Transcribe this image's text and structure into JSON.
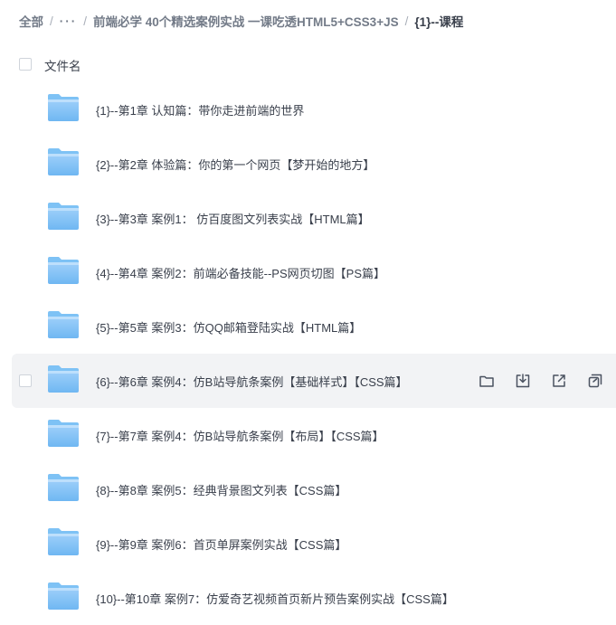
{
  "breadcrumb": {
    "root": "全部",
    "ellipsis": "···",
    "parent": "前端必学 40个精选案例实战 一课吃透HTML5+CSS3+JS",
    "current": "{1}--课程",
    "separator": "/"
  },
  "list_header": {
    "name_label": "文件名"
  },
  "files": [
    {
      "name": "{1}--第1章 认知篇：带你走进前端的世界"
    },
    {
      "name": "{2}--第2章 体验篇：你的第一个网页【梦开始的地方】"
    },
    {
      "name": "{3}--第3章 案例1： 仿百度图文列表实战【HTML篇】"
    },
    {
      "name": "{4}--第4章 案例2：前端必备技能--PS网页切图【PS篇】"
    },
    {
      "name": "{5}--第5章 案例3：仿QQ邮箱登陆实战【HTML篇】"
    },
    {
      "name": "{6}--第6章 案例4：仿B站导航条案例【基础样式】【CSS篇】"
    },
    {
      "name": "{7}--第7章 案例4：仿B站导航条案例【布局】【CSS篇】"
    },
    {
      "name": "{8}--第8章 案例5：经典背景图文列表【CSS篇】"
    },
    {
      "name": "{9}--第9章 案例6：首页单屏案例实战【CSS篇】"
    },
    {
      "name": "{10}--第10章 案例7：仿爱奇艺视频首页新片预告案例实战【CSS篇】"
    }
  ],
  "hovered_row_index": 5,
  "row_actions": [
    "folder-open-icon",
    "download-icon",
    "share-icon",
    "copy-link-icon"
  ],
  "colors": {
    "folder_light": "#b5dcfb",
    "folder_dark": "#7ec2f5",
    "hover_bg": "#f2f3f5"
  }
}
